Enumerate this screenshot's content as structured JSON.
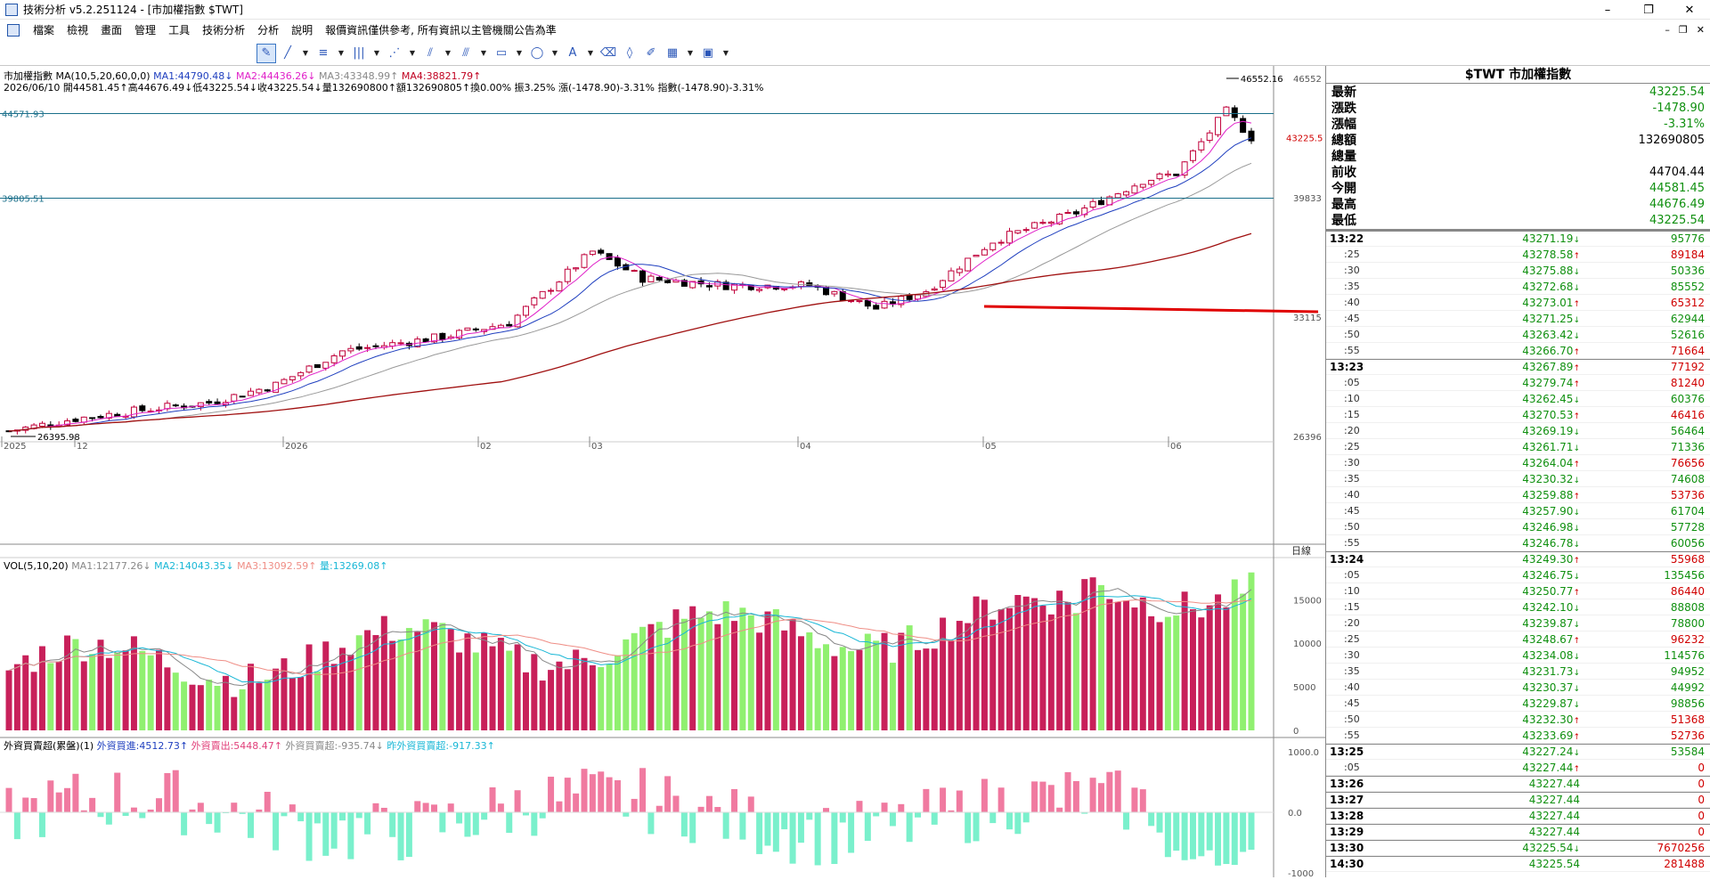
{
  "window": {
    "title": "技術分析 v5.2.251124 - [市加權指數 $TWT]",
    "minimize": "–",
    "maximize": "❐",
    "close": "✕"
  },
  "menu": {
    "items": [
      "檔案",
      "檢視",
      "畫面",
      "管理",
      "工具",
      "技術分析",
      "分析",
      "說明",
      "報價資訊僅供參考, 所有資訊以主管機關公告為準"
    ],
    "mdi_min": "–",
    "mdi_restore": "❐",
    "mdi_close": "✕"
  },
  "toolbar": {
    "icons": [
      "cursor-draw-icon",
      "line-icon",
      "trend-icon",
      "grid-lines-icon",
      "fan-icon",
      "channel-icon",
      "parallel-icon",
      "rectangle-icon",
      "ellipse-icon",
      "text-icon",
      "erase-icon",
      "eraser-icon",
      "edit-icon",
      "color-palette-icon",
      "save-icon"
    ]
  },
  "price_panel": {
    "indicator_label": "市加權指數 MA(10,5,20,60,0,0)",
    "ma1": "MA1:44790.48↓",
    "ma2": "MA2:44436.26↓",
    "ma3": "MA3:43348.99↑",
    "ma4": "MA4:38821.79↑",
    "info_line": "2026/06/10 開44581.45↑高44676.49↓低43225.54↓收43225.54↓量132690800↑額132690805↑換0.00% 振3.25% 漲(-1478.90)-3.31% 指數(-1478.90)-3.31%",
    "hline1": "44571.93",
    "hline2": "39805.51",
    "high_label": "46552.16",
    "low_label": "26395.98",
    "close_tag": "43225.5",
    "y_ticks": [
      "46552",
      "39833",
      "33115",
      "26396"
    ],
    "x_labels": [
      "2025",
      "12",
      "2026",
      "02",
      "03",
      "04",
      "05",
      "06"
    ],
    "x_unit": "日線"
  },
  "vol_panel": {
    "label": "VOL(5,10,20)",
    "ma1": "MA1:12177.26↓",
    "ma2": "MA2:14043.35↓",
    "ma3": "MA3:13092.59↑",
    "vol": "量:13269.08↑",
    "y_ticks": [
      "15000",
      "10000",
      "5000",
      "0"
    ]
  },
  "fi_panel": {
    "label": "外資買賣超(累盤)(1)",
    "buy": "外資買進:4512.73↑",
    "sell": "外資賣出:5448.47↑",
    "net": "外資買賣超:-935.74↓",
    "prev": "昨外資買賣超:-917.33↑",
    "y_ticks": [
      "1000.0",
      "0.0",
      "-1000"
    ]
  },
  "quote": {
    "title": "$TWT 市加權指數",
    "rows": [
      {
        "label": "最新",
        "value": "43225.54",
        "color": "green"
      },
      {
        "label": "漲跌",
        "value": "-1478.90",
        "color": "green"
      },
      {
        "label": "漲幅",
        "value": "-3.31%",
        "color": "green"
      },
      {
        "label": "總額",
        "value": "132690805",
        "color": "black"
      },
      {
        "label": "總量",
        "value": "",
        "color": "black"
      },
      {
        "label": "前收",
        "value": "44704.44",
        "color": "black"
      },
      {
        "label": "今開",
        "value": "44581.45",
        "color": "green"
      },
      {
        "label": "最高",
        "value": "44676.49",
        "color": "green"
      },
      {
        "label": "最低",
        "value": "43225.54",
        "color": "green"
      }
    ],
    "ticks": [
      {
        "t": "13:22",
        "p": "43271.19",
        "a": "↓",
        "v": "95776",
        "vc": "green",
        "major": true
      },
      {
        "t": ":25",
        "p": "43278.58",
        "a": "↑",
        "v": "89184",
        "vc": "red"
      },
      {
        "t": ":30",
        "p": "43275.88",
        "a": "↓",
        "v": "50336",
        "vc": "green"
      },
      {
        "t": ":35",
        "p": "43272.68",
        "a": "↓",
        "v": "85552",
        "vc": "green"
      },
      {
        "t": ":40",
        "p": "43273.01",
        "a": "↑",
        "v": "65312",
        "vc": "red"
      },
      {
        "t": ":45",
        "p": "43271.25",
        "a": "↓",
        "v": "62944",
        "vc": "green"
      },
      {
        "t": ":50",
        "p": "43263.42",
        "a": "↓",
        "v": "52616",
        "vc": "green"
      },
      {
        "t": ":55",
        "p": "43266.70",
        "a": "↑",
        "v": "71664",
        "vc": "red"
      },
      {
        "t": "13:23",
        "p": "43267.89",
        "a": "↑",
        "v": "77192",
        "vc": "red",
        "major": true
      },
      {
        "t": ":05",
        "p": "43279.74",
        "a": "↑",
        "v": "81240",
        "vc": "red"
      },
      {
        "t": ":10",
        "p": "43262.45",
        "a": "↓",
        "v": "60376",
        "vc": "green"
      },
      {
        "t": ":15",
        "p": "43270.53",
        "a": "↑",
        "v": "46416",
        "vc": "red"
      },
      {
        "t": ":20",
        "p": "43269.19",
        "a": "↓",
        "v": "56464",
        "vc": "green"
      },
      {
        "t": ":25",
        "p": "43261.71",
        "a": "↓",
        "v": "71336",
        "vc": "green"
      },
      {
        "t": ":30",
        "p": "43264.04",
        "a": "↑",
        "v": "76656",
        "vc": "red"
      },
      {
        "t": ":35",
        "p": "43230.32",
        "a": "↓",
        "v": "74608",
        "vc": "green"
      },
      {
        "t": ":40",
        "p": "43259.88",
        "a": "↑",
        "v": "53736",
        "vc": "red"
      },
      {
        "t": ":45",
        "p": "43257.90",
        "a": "↓",
        "v": "61704",
        "vc": "green"
      },
      {
        "t": ":50",
        "p": "43246.98",
        "a": "↓",
        "v": "57728",
        "vc": "green"
      },
      {
        "t": ":55",
        "p": "43246.78",
        "a": "↓",
        "v": "60056",
        "vc": "green"
      },
      {
        "t": "13:24",
        "p": "43249.30",
        "a": "↑",
        "v": "55968",
        "vc": "red",
        "major": true
      },
      {
        "t": ":05",
        "p": "43246.75",
        "a": "↓",
        "v": "135456",
        "vc": "green"
      },
      {
        "t": ":10",
        "p": "43250.77",
        "a": "↑",
        "v": "86440",
        "vc": "red"
      },
      {
        "t": ":15",
        "p": "43242.10",
        "a": "↓",
        "v": "88808",
        "vc": "green"
      },
      {
        "t": ":20",
        "p": "43239.87",
        "a": "↓",
        "v": "78800",
        "vc": "green"
      },
      {
        "t": ":25",
        "p": "43248.67",
        "a": "↑",
        "v": "96232",
        "vc": "red"
      },
      {
        "t": ":30",
        "p": "43234.08",
        "a": "↓",
        "v": "114576",
        "vc": "green"
      },
      {
        "t": ":35",
        "p": "43231.73",
        "a": "↓",
        "v": "94952",
        "vc": "green"
      },
      {
        "t": ":40",
        "p": "43230.37",
        "a": "↓",
        "v": "44992",
        "vc": "green"
      },
      {
        "t": ":45",
        "p": "43229.87",
        "a": "↓",
        "v": "98856",
        "vc": "green"
      },
      {
        "t": ":50",
        "p": "43232.30",
        "a": "↑",
        "v": "51368",
        "vc": "red"
      },
      {
        "t": ":55",
        "p": "43233.69",
        "a": "↑",
        "v": "52736",
        "vc": "red"
      },
      {
        "t": "13:25",
        "p": "43227.24",
        "a": "↓",
        "v": "53584",
        "vc": "green",
        "major": true
      },
      {
        "t": ":05",
        "p": "43227.44",
        "a": "↑",
        "v": "0",
        "vc": "red"
      },
      {
        "t": "13:26",
        "p": "43227.44",
        "a": "",
        "v": "0",
        "vc": "red",
        "major": true
      },
      {
        "t": "13:27",
        "p": "43227.44",
        "a": "",
        "v": "0",
        "vc": "red",
        "major": true
      },
      {
        "t": "13:28",
        "p": "43227.44",
        "a": "",
        "v": "0",
        "vc": "red",
        "major": true
      },
      {
        "t": "13:29",
        "p": "43227.44",
        "a": "",
        "v": "0",
        "vc": "red",
        "major": true
      },
      {
        "t": "13:30",
        "p": "43225.54",
        "a": "↓",
        "v": "7670256",
        "vc": "red",
        "major": true
      },
      {
        "t": "14:30",
        "p": "43225.54",
        "a": "",
        "v": "281488",
        "vc": "red",
        "major": true
      }
    ]
  }
}
